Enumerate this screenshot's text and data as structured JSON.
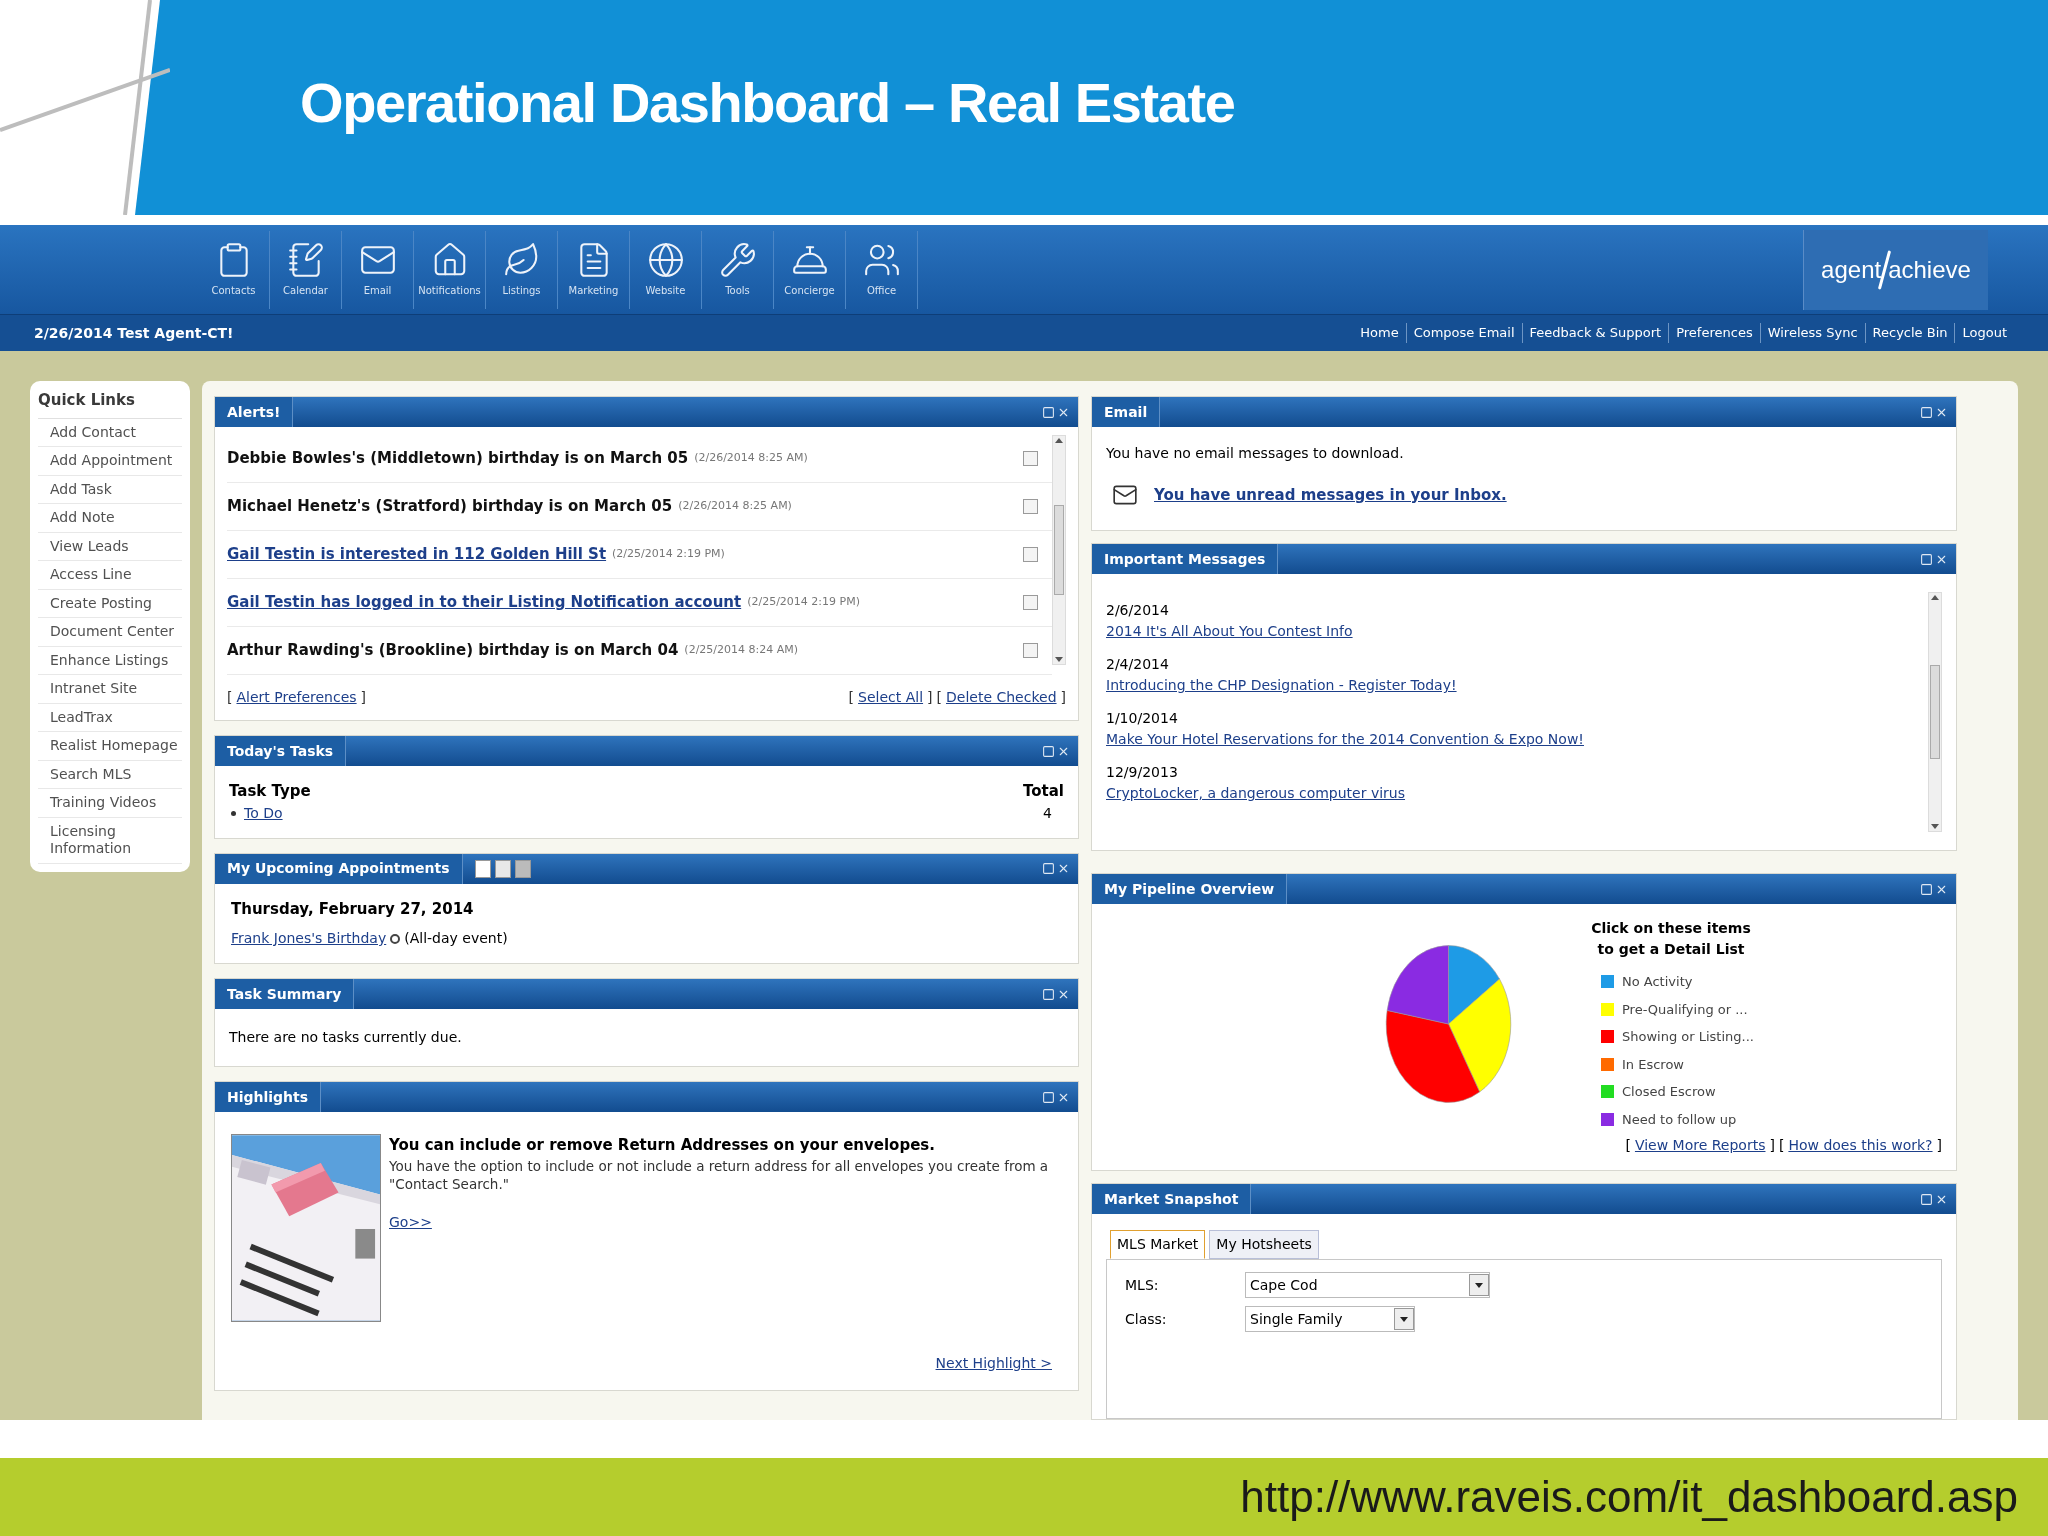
{
  "slide": {
    "title": "Operational Dashboard – Real Estate",
    "url": "http://www.raveis.com/it_dashboard.asp"
  },
  "nav_icons": [
    {
      "kind": "contacts",
      "label": "Contacts"
    },
    {
      "kind": "calendar",
      "label": "Calendar"
    },
    {
      "kind": "email",
      "label": "Email"
    },
    {
      "kind": "notifications",
      "label": "Notifications"
    },
    {
      "kind": "listings",
      "label": "Listings"
    },
    {
      "kind": "marketing",
      "label": "Marketing"
    },
    {
      "kind": "website",
      "label": "Website"
    },
    {
      "kind": "tools",
      "label": "Tools"
    },
    {
      "kind": "concierge",
      "label": "Concierge"
    },
    {
      "kind": "office",
      "label": "Office"
    }
  ],
  "logo_words": [
    "agent",
    "achieve"
  ],
  "user_line": "2/26/2014 Test Agent-CT!",
  "top_links": [
    "Home",
    "Compose Email",
    "Feedback & Support",
    "Preferences",
    "Wireless Sync",
    "Recycle Bin",
    "Logout"
  ],
  "quick_links": {
    "title": "Quick Links",
    "items": [
      "Add Contact",
      "Add Appointment",
      "Add Task",
      "Add Note",
      "View Leads",
      "Access Line",
      "Create Posting",
      "Document Center",
      "Enhance Listings",
      "Intranet Site",
      "LeadTrax",
      "Realist Homepage",
      "Search MLS",
      "Training Videos",
      "Licensing Information"
    ]
  },
  "alerts": {
    "title": "Alerts!",
    "rows": [
      {
        "text": "Debbie Bowles's (Middletown) birthday is on March 05",
        "timestamp": "(2/26/2014 8:25 AM)",
        "kind": "note",
        "checked": false
      },
      {
        "text": "Michael Henetz's (Stratford) birthday is on March 05",
        "timestamp": "(2/26/2014 8:25 AM)",
        "kind": "note",
        "checked": false
      },
      {
        "text": "Gail Testin is interested in 112 Golden Hill St",
        "timestamp": "(2/25/2014 2:19 PM)",
        "kind": "link",
        "checked": false
      },
      {
        "text": "Gail Testin has logged in to their Listing Notification account",
        "timestamp": "(2/25/2014 2:19 PM)",
        "kind": "link",
        "checked": false
      },
      {
        "text": "Arthur Rawding's (Brookline) birthday is on March 04",
        "timestamp": "(2/25/2014 8:24 AM)",
        "kind": "note",
        "checked": false
      }
    ],
    "brackets": [
      "[",
      "]",
      "[",
      "]",
      "[",
      "]"
    ],
    "left_link": "Alert Preferences",
    "right_links": [
      "Select All",
      "Delete Checked"
    ]
  },
  "tasks": {
    "title": "Today's Tasks",
    "column_1": "Task Type",
    "column_2": "Total",
    "rows": [
      {
        "type": "To Do",
        "total": "4"
      }
    ]
  },
  "appointments": {
    "title": "My Upcoming Appointments",
    "date": "Thursday, February 27, 2014",
    "event": "Frank Jones's Birthday",
    "note": "(All-day event)"
  },
  "task_summary": {
    "title": "Task Summary",
    "text": "There are no tasks currently due."
  },
  "highlights": {
    "title": "Highlights",
    "heading": "You can include or remove Return Addresses on your envelopes.",
    "body": "You have the option to include or not include a return address for all envelopes you create from a \"Contact Search.\"",
    "go_link": "Go>>",
    "next_link": "Next Highlight >"
  },
  "email": {
    "title": "Email",
    "status": "You have no email messages to download.",
    "inbox_link": "You have unread messages in your Inbox."
  },
  "messages": {
    "title": "Important Messages",
    "items": [
      {
        "date": "2/6/2014",
        "link": "2014 It's All About You Contest Info"
      },
      {
        "date": "2/4/2014",
        "link": "Introducing the CHP Designation - Register Today!"
      },
      {
        "date": "1/10/2014",
        "link": "Make Your Hotel Reservations for the 2014 Convention & Expo Now!"
      },
      {
        "date": "12/9/2013",
        "link": "CryptoLocker, a dangerous computer virus"
      }
    ]
  },
  "pipeline": {
    "title": "My Pipeline Overview",
    "legend_title": "Click on these items to get a Detail List",
    "legend": [
      {
        "label": "No Activity",
        "color": "#1e9be6"
      },
      {
        "label": "Pre-Qualifying or ...",
        "color": "#ffff00"
      },
      {
        "label": "Showing or Listing...",
        "color": "#ff0000"
      },
      {
        "label": "In Escrow",
        "color": "#ff6a00"
      },
      {
        "label": "Closed Escrow",
        "color": "#22dd22"
      },
      {
        "label": "Need to follow up",
        "color": "#8a2be2"
      }
    ],
    "brackets": [
      "[",
      "]",
      "[",
      "]"
    ],
    "links": [
      "View More Reports",
      "How does this work?"
    ]
  },
  "market": {
    "title": "Market Snapshot",
    "tabs": [
      {
        "label": "MLS Market",
        "selected": true
      },
      {
        "label": "My Hotsheets",
        "selected": false
      }
    ],
    "fields": [
      {
        "label": "MLS:",
        "value": "Cape Cod"
      },
      {
        "label": "Class:",
        "value": "Single Family"
      }
    ]
  }
}
